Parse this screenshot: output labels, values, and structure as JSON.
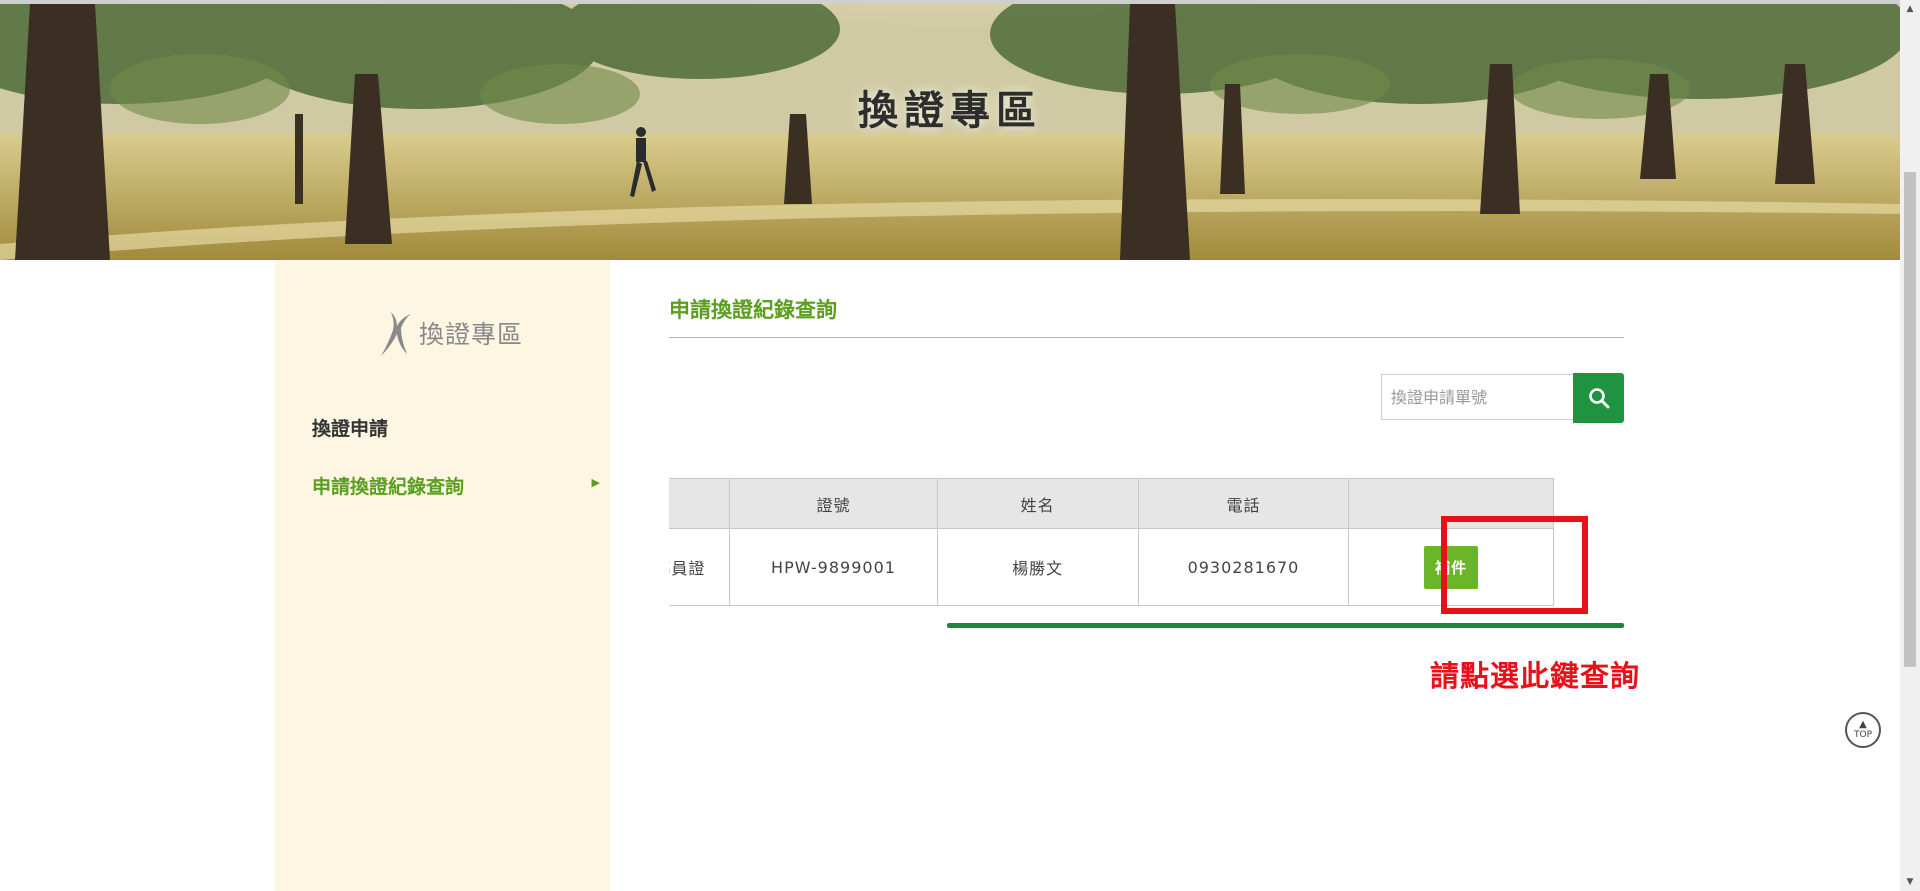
{
  "banner": {
    "title": "換證專區"
  },
  "sidebar": {
    "logo_text": "換證專區",
    "items": [
      {
        "label": "換證申請",
        "active": false
      },
      {
        "label": "申請換證紀錄查詢",
        "active": true
      }
    ]
  },
  "main": {
    "heading": "申請換證紀錄查詢",
    "search": {
      "placeholder": "換證申請單號",
      "value": ""
    },
    "table": {
      "headers": [
        "",
        "證號",
        "姓名",
        "電話",
        ""
      ],
      "rows": [
        {
          "type": "導員證",
          "cert_no": "HPW-9899001",
          "name": "楊勝文",
          "phone": "0930281670",
          "action": "補件"
        }
      ]
    }
  },
  "annotation": {
    "text": "請點選此鍵查詢"
  },
  "top_button": {
    "label": "TOP"
  },
  "colors": {
    "accent_green": "#5c9e1f",
    "button_green": "#6bb52a",
    "search_green": "#1e9440",
    "annotation_red": "#e8101a"
  },
  "icons": {
    "search": "search-icon",
    "top_arrow": "arrow-up-icon",
    "logo": "runner-logo-icon"
  }
}
